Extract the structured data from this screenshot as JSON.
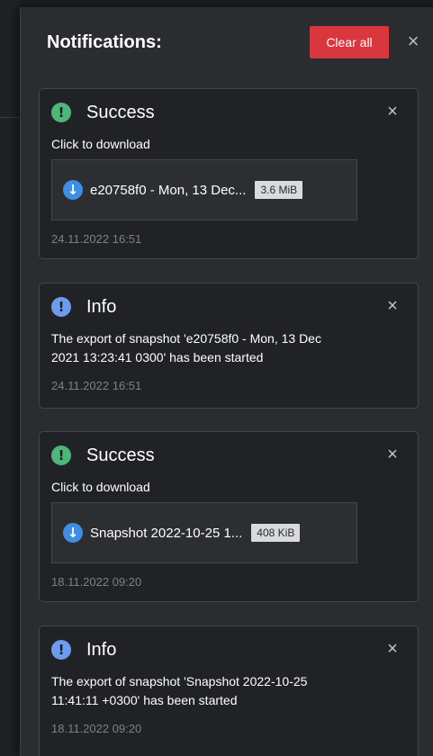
{
  "panel": {
    "title": "Notifications:",
    "clear_all_label": "Clear all",
    "close_symbol": "×"
  },
  "notifications": [
    {
      "type": "Success",
      "icon": "exclamation-icon",
      "text": "Click to download",
      "download": {
        "name": "e20758f0 - Mon, 13 Dec...",
        "size": "3.6 MiB"
      },
      "date": "24.11.2022 16:51"
    },
    {
      "type": "Info",
      "icon": "exclamation-icon",
      "text": "The export of snapshot 'e20758f0 - Mon, 13 Dec 2021 13:23:41 0300' has been started",
      "date": "24.11.2022 16:51"
    },
    {
      "type": "Success",
      "icon": "exclamation-icon",
      "text": "Click to download",
      "download": {
        "name": "Snapshot 2022-10-25 1...",
        "size": "408 KiB"
      },
      "date": "18.11.2022 09:20"
    },
    {
      "type": "Info",
      "icon": "exclamation-icon",
      "text": "The export of snapshot 'Snapshot 2022-10-25 11:41:11 +0300' has been started",
      "date": "18.11.2022 09:20"
    }
  ],
  "colors": {
    "success": "#4fb67a",
    "info": "#6d9bef",
    "danger": "#d9363e",
    "download_icon": "#3f8de4"
  }
}
